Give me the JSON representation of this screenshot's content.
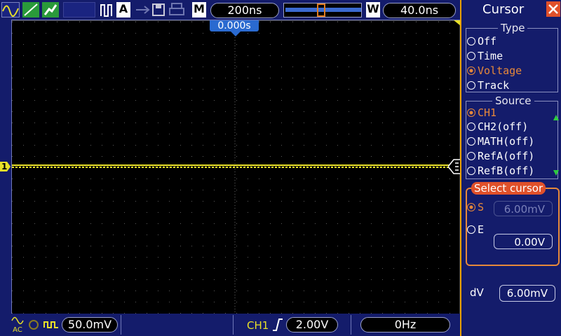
{
  "top": {
    "mode_letter": "M",
    "timebase": "200ns",
    "window_letter": "W",
    "window_time": "40.0ns",
    "trigger_mode_letter": "A",
    "trigger_position": "0.000s"
  },
  "panel": {
    "title": "Cursor",
    "type_group": {
      "label": "Type",
      "options": [
        "Off",
        "Time",
        "Voltage",
        "Track"
      ],
      "selected": 2
    },
    "source_group": {
      "label": "Source",
      "options": [
        "CH1",
        "CH2(off)",
        "MATH(off)",
        "RefA(off)",
        "RefB(off)"
      ],
      "selected": 0
    },
    "select_cursor": {
      "label": "Select cursor",
      "s_label": "S",
      "s_value": "6.00mV",
      "e_label": "E",
      "e_value": "0.00V"
    },
    "dv_label": "dV",
    "dv_value": "6.00mV"
  },
  "bottom": {
    "ch_scale": "50.0mV",
    "trigger_channel": "CH1",
    "trigger_level": "2.00V",
    "frequency": "0Hz",
    "coupling": "AC"
  },
  "markers": {
    "ch1_marker": "1"
  },
  "colors": {
    "trace": "#e8e028",
    "accent": "#e9a000",
    "selected": "#e6883a",
    "close_button": "#e0502a"
  }
}
